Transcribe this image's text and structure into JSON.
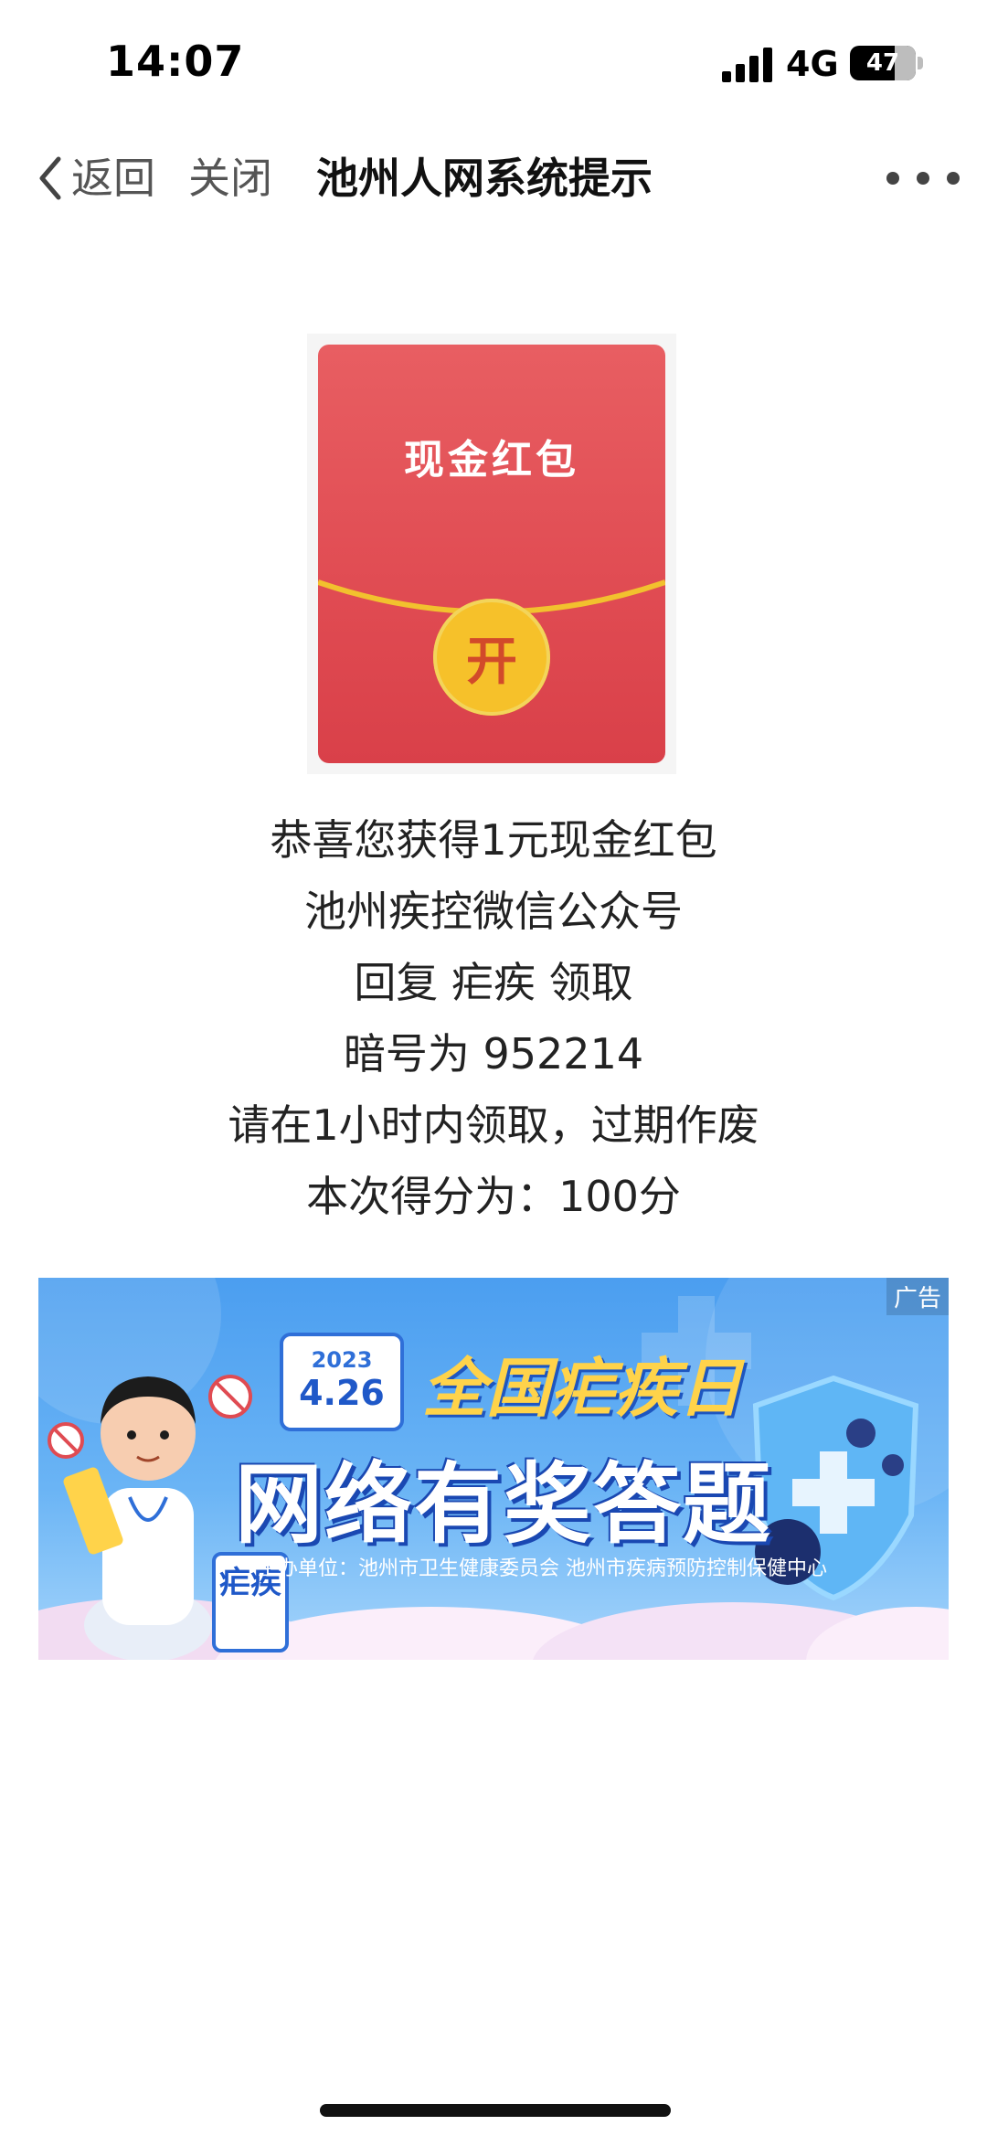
{
  "status_bar": {
    "time": "14:07",
    "network": "4G",
    "battery": "47",
    "battery_level_percent": 47
  },
  "nav": {
    "back_label": "返回",
    "close_label": "关闭",
    "title": "池州人网系统提示"
  },
  "envelope": {
    "title": "现金红包",
    "seal_glyph": "开"
  },
  "messages": [
    "恭喜您获得1元现金红包",
    "池州疾控微信公众号",
    "回复 疟疾 领取",
    "暗号为 952214",
    "请在1小时内领取，过期作废",
    "本次得分为：100分"
  ],
  "ad": {
    "tag": "广告",
    "year": "2023",
    "date": "4.26",
    "title_line1": "全国疟疾日",
    "title_line2": "网络有奖答题",
    "sponsor": "主办单位：池州市卫生健康委员会  池州市疾病预防控制保健中心",
    "clipboard_text": "疟疾"
  }
}
